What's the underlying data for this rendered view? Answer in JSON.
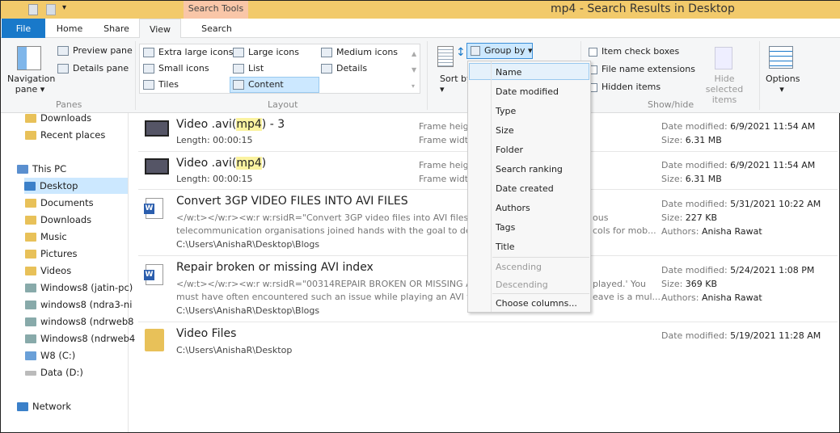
{
  "window": {
    "title": "mp4 - Search Results in Desktop",
    "context_tab": "Search Tools"
  },
  "tabs": [
    "File",
    "Home",
    "Share",
    "View",
    "Search"
  ],
  "ribbon": {
    "panes": {
      "navigation_pane": "Navigation pane",
      "preview_pane": "Preview pane",
      "details_pane": "Details pane",
      "label": "Panes"
    },
    "layout": {
      "items": [
        "Extra large icons",
        "Large icons",
        "Medium icons",
        "Small icons",
        "List",
        "Details",
        "Tiles",
        "Content"
      ],
      "selected": "Content",
      "label": "Layout"
    },
    "sort_by": "Sort by",
    "group_by": "Group by",
    "show_hide": {
      "item_check_boxes": "Item check boxes",
      "file_name_extensions": "File name extensions",
      "hidden_items": "Hidden items",
      "hide_selected": "Hide selected items",
      "label": "Show/hide"
    },
    "options": "Options"
  },
  "nav": [
    "Downloads",
    "Recent places",
    "This PC",
    "Desktop",
    "Documents",
    "Downloads",
    "Music",
    "Pictures",
    "Videos",
    "Windows8 (jatin-pc)",
    "windows8 (ndra3-ni",
    "windows8 (ndrweb8",
    "Windows8 (ndrweb4",
    "W8 (C:)",
    "Data (D:)",
    "Network"
  ],
  "results": [
    {
      "title_pre": "Video .avi(",
      "title_hl": "mp4",
      "title_post": ") - 3",
      "line1": "Length: 00:00:15",
      "meta1": "Frame heig",
      "meta2": "Frame widt",
      "date": "6/9/2021 11:54 AM",
      "size": "6.31 MB"
    },
    {
      "title_pre": "Video .avi(",
      "title_hl": "mp4",
      "title_post": ")",
      "line1": "Length: 00:00:15",
      "meta1": "Frame heig",
      "meta2": "Frame widt",
      "date": "6/9/2021 11:54 AM",
      "size": "6.31 MB"
    },
    {
      "title": "Convert 3GP VIDEO FILES INTO AVI FILES",
      "snip1": "</w:t></w:r><w:r w:rsidR=\"Convert 3GP video files into AVI files Wh",
      "snip1b": "ous",
      "snip2": "telecommunication organisations joined hands with the goal to deve",
      "snip2b": "cols for mob...",
      "path": "C:\\Users\\AnishaR\\Desktop\\Blogs",
      "date": "5/31/2021 10:22 AM",
      "size": "227 KB",
      "authors": "Anisha Rawat"
    },
    {
      "title": "Repair broken or missing AVI index",
      "snip1": "</w:t></w:r><w:r w:rsidR=\"00314REPAIR BROKEN OR MISSING AVI",
      "snip1b": "played.' You",
      "snip2": "must have often encountered such an issue while playing an AVI file",
      "snip2b": "eave is a mul...",
      "path": "C:\\Users\\AnishaR\\Desktop\\Blogs",
      "date": "5/24/2021 1:08 PM",
      "size": "369 KB",
      "authors": "Anisha Rawat"
    },
    {
      "title": "Video Files",
      "path": "C:\\Users\\AnishaR\\Desktop",
      "date": "5/19/2021 11:28 AM"
    }
  ],
  "labels": {
    "date_modified": "Date modified:",
    "size": "Size:",
    "authors": "Authors:"
  },
  "group_menu": {
    "items": [
      "Name",
      "Date modified",
      "Type",
      "Size",
      "Folder",
      "Search ranking",
      "Date created",
      "Authors",
      "Tags",
      "Title"
    ],
    "selected": "Name",
    "order": [
      "Ascending",
      "Descending"
    ],
    "choose_columns": "Choose columns..."
  },
  "colors": {
    "file_tab": "#1979ca",
    "title_bar": "#f2ca6b",
    "selection": "#cce8ff"
  }
}
